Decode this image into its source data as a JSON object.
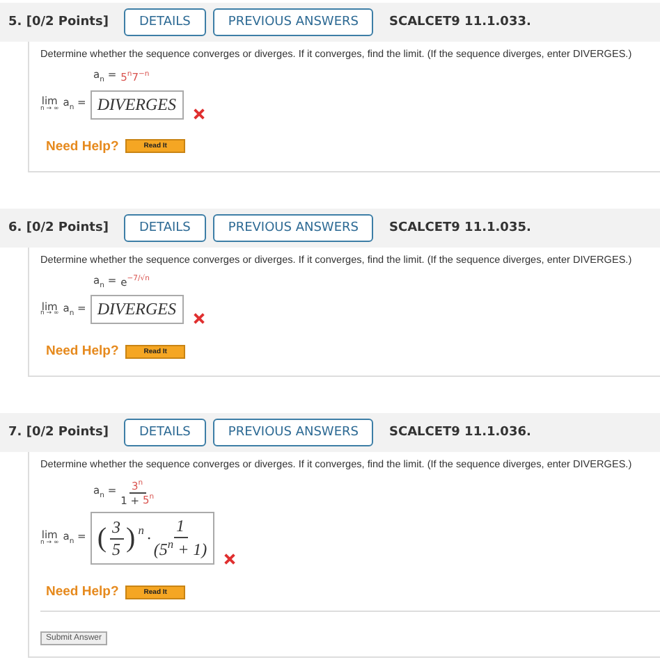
{
  "questions": [
    {
      "number": "5.",
      "points": "[0/2 Points]",
      "buttons": [
        "DETAILS",
        "PREVIOUS ANSWERS"
      ],
      "code": "SCALCET9 11.1.033.",
      "prompt": "Determine whether the sequence converges or diverges. If it converges, find the limit. (If the sequence diverges, enter DIVERGES.)",
      "formula": {
        "kind": "inline",
        "lhs": "a$_{n}$ =",
        "parts": [
          {
            "text": "5$^{n}$7$^{−n}$",
            "highlight": true
          }
        ]
      },
      "limit": {
        "lim": "lim",
        "under": "n → ∞",
        "lhs": "a$_{n}$ ="
      },
      "answer": {
        "kind": "text",
        "text": "DIVERGES"
      },
      "incorrect": true,
      "help": "Need Help?",
      "help_button": "Read It"
    },
    {
      "number": "6.",
      "points": "[0/2 Points]",
      "buttons": [
        "DETAILS",
        "PREVIOUS ANSWERS"
      ],
      "code": "SCALCET9 11.1.035.",
      "prompt": "Determine whether the sequence converges or diverges. If it converges, find the limit. (If the sequence diverges, enter DIVERGES.)",
      "formula": {
        "kind": "inline",
        "lhs": "a$_{n}$ =",
        "parts": [
          {
            "text": "e",
            "highlight": false
          },
          {
            "text": "$^{−7/√n}$",
            "highlight": true
          }
        ]
      },
      "limit": {
        "lim": "lim",
        "under": "n → ∞",
        "lhs": "a$_{n}$ ="
      },
      "answer": {
        "kind": "text",
        "text": "DIVERGES"
      },
      "incorrect": true,
      "help": "Need Help?",
      "help_button": "Read It"
    },
    {
      "number": "7.",
      "points": "[0/2 Points]",
      "buttons": [
        "DETAILS",
        "PREVIOUS ANSWERS"
      ],
      "code": "SCALCET9 11.1.036.",
      "prompt": "Determine whether the sequence converges or diverges. If it converges, find the limit. (If the sequence diverges, enter DIVERGES.)",
      "formula": {
        "kind": "fraction",
        "lhs": "a$_{n}$ =",
        "numerator": [
          {
            "text": "3$^{n}$",
            "highlight": true
          }
        ],
        "denominator": [
          {
            "text": "1 + ",
            "highlight": false
          },
          {
            "text": "5$^{n}$",
            "highlight": true
          }
        ]
      },
      "limit": {
        "lim": "lim",
        "under": "n → ∞",
        "lhs": "a$_{n}$ ="
      },
      "answer": {
        "kind": "expression",
        "open": "(",
        "close": ")",
        "base_numerator": "3",
        "base_denominator": "5",
        "power": "n",
        "dot": "·",
        "numerator": "1",
        "denominator": "(5$^{n}$ + 1)"
      },
      "incorrect": true,
      "help": "Need Help?",
      "help_button": "Read It",
      "submit": "Submit Answer"
    }
  ]
}
